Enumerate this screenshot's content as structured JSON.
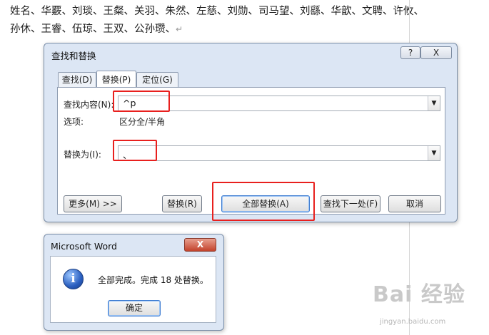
{
  "document": {
    "line1": "姓名、华覈、刘琰、王粲、关羽、朱然、左慈、刘勋、司马望、刘繇、华歆、文聘、许攸、",
    "line2": "孙休、王睿、伍琼、王双、公孙瓒、",
    "pilcrow": "↵"
  },
  "find_replace": {
    "title": "查找和替换",
    "help": "?",
    "close": "X",
    "tabs": [
      {
        "label": "查找(D)",
        "active": false
      },
      {
        "label": "替换(P)",
        "active": true
      },
      {
        "label": "定位(G)",
        "active": false
      }
    ],
    "find_label": "查找内容(N):",
    "find_value": "^p",
    "options_label": "选项:",
    "options_value": "区分全/半角",
    "replace_label": "替换为(I):",
    "replace_value": "、",
    "buttons": {
      "more": "更多(M) >>",
      "replace": "替换(R)",
      "replace_all": "全部替换(A)",
      "find_next": "查找下一处(F)",
      "cancel": "取消"
    }
  },
  "message_box": {
    "title": "Microsoft Word",
    "close": "X",
    "icon": "info-icon",
    "message": "全部完成。完成 18 处替换。",
    "ok": "确定"
  },
  "watermark": {
    "brand": "Bai 经验",
    "url": "jingyan.baidu.com"
  },
  "colors": {
    "highlight": "#e8201e",
    "dialog_bg": "#dce6f4"
  }
}
